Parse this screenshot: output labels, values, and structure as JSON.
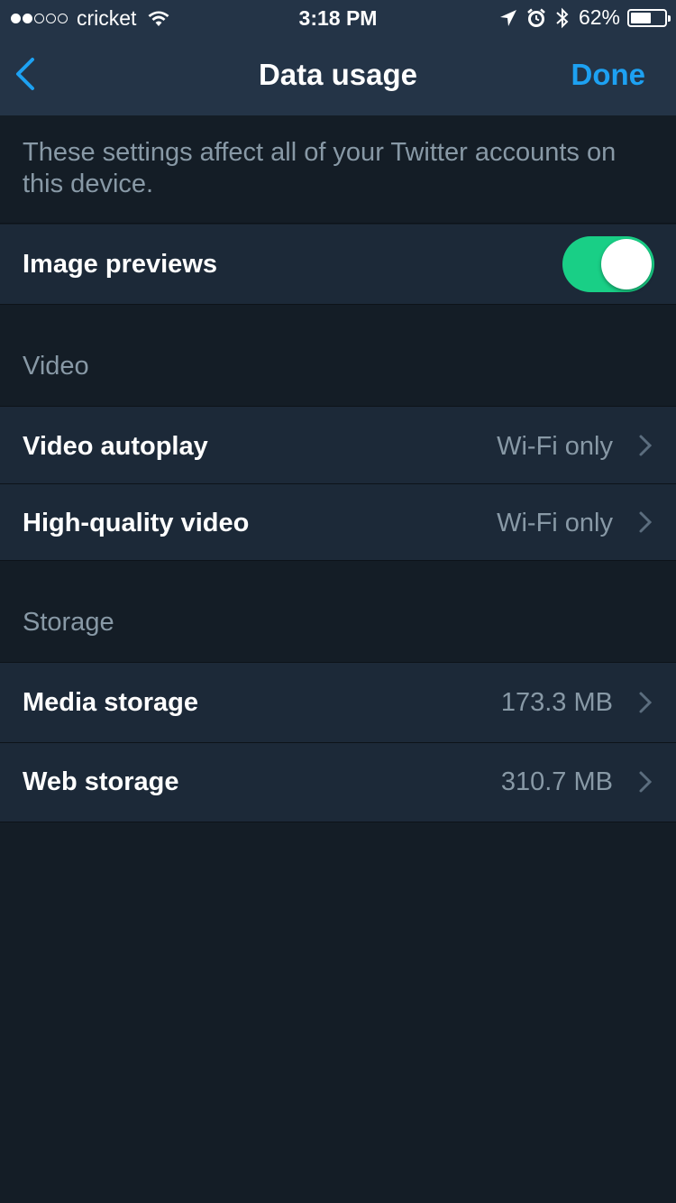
{
  "status_bar": {
    "carrier": "cricket",
    "signal_dots_filled": 2,
    "signal_dots_total": 5,
    "time": "3:18 PM",
    "battery_percent": "62%",
    "battery_level": 0.62
  },
  "nav": {
    "title": "Data usage",
    "done_label": "Done",
    "back_icon": "chevron-left-icon"
  },
  "info_text": "These settings affect all of your Twitter accounts on this device.",
  "image_previews": {
    "label": "Image previews",
    "enabled": true
  },
  "video_section": {
    "header": "Video",
    "rows": [
      {
        "label": "Video autoplay",
        "value": "Wi-Fi only"
      },
      {
        "label": "High-quality video",
        "value": "Wi-Fi only"
      }
    ]
  },
  "storage_section": {
    "header": "Storage",
    "rows": [
      {
        "label": "Media storage",
        "value": "173.3 MB"
      },
      {
        "label": "Web storage",
        "value": "310.7 MB"
      }
    ]
  },
  "colors": {
    "accent": "#1da1f2",
    "toggle_on": "#19cf86",
    "background": "#141d26",
    "row_background": "#1c2938",
    "nav_background": "#243447",
    "secondary_text": "#8899a6"
  }
}
